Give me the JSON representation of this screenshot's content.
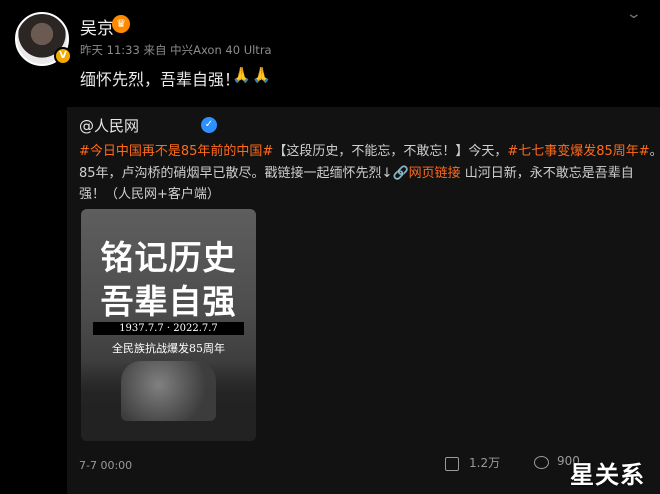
{
  "author": {
    "name": "吴京",
    "meta": "昨天 11:33 来自 中兴Axon 40 Ultra"
  },
  "post": {
    "text": "缅怀先烈，吾辈自强！",
    "emoji": "🙏"
  },
  "repost": {
    "author": "@人民网",
    "line1": [
      {
        "t": "#今日中国再不是85年前的中国#",
        "hl": true
      },
      {
        "t": "【这段历史，不能忘，不敢忘！】今天，",
        "hl": false
      },
      {
        "t": "#七七事变爆发85周年#",
        "hl": true
      },
      {
        "t": "。",
        "hl": false
      }
    ],
    "line2a": "85年，卢沟桥的硝烟早已散尽。戳链接一起缅怀先烈↓",
    "line2b": "网页链接",
    "line2c": " 山河日新，永不敢忘是吾辈自",
    "line3": "强！（人民网+客户端）",
    "poster": {
      "title1": "铭记历史",
      "title2": "吾辈自强",
      "date": "1937.7.7 · 2022.7.7",
      "subtitle": "全民族抗战爆发85周年"
    },
    "time": "7-7 00:00",
    "shares": "1.2万",
    "comments": "900"
  },
  "watermark": "星关系",
  "colors": {
    "highlight": "#ff6a1a",
    "verified": "#2e8fff",
    "badge": "#f2a900"
  }
}
